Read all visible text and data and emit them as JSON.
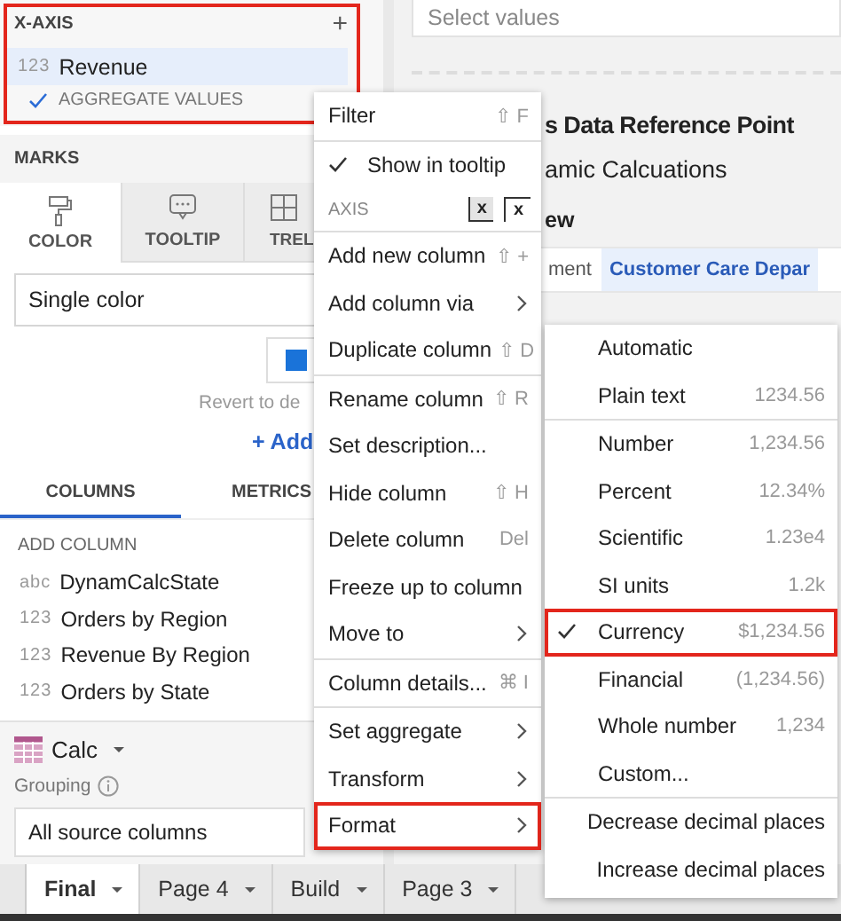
{
  "x_axis": {
    "title": "X-AXIS",
    "add": "+",
    "highlighted": true,
    "field": {
      "type": "123",
      "name": "Revenue"
    },
    "aggregate": {
      "label": "AGGREGATE VALUES",
      "checked": true
    }
  },
  "marks": {
    "title": "MARKS",
    "tabs": [
      {
        "label": "COLOR",
        "selected": true
      },
      {
        "label": "TOOLTIP",
        "selected": false
      },
      {
        "label": "TREL",
        "selected": false
      }
    ],
    "color_mode": "Single color",
    "revert": "Revert to de",
    "add": "+ Add"
  },
  "panel_tabs": [
    {
      "label": "COLUMNS",
      "selected": true
    },
    {
      "label": "METRICS",
      "selected": false
    }
  ],
  "add_column": "ADD COLUMN",
  "columns": [
    {
      "type": "abc",
      "name": "DynamCalcState"
    },
    {
      "type": "123",
      "name": "Orders by Region"
    },
    {
      "type": "123",
      "name": "Revenue By Region"
    },
    {
      "type": "123",
      "name": "Orders by State"
    }
  ],
  "element": {
    "name": "Calc",
    "grouping_label": "Grouping",
    "grouping_value": "All source columns"
  },
  "page_tabs": [
    {
      "label": "Final",
      "selected": true
    },
    {
      "label": "Page 4",
      "selected": false
    },
    {
      "label": "Build",
      "selected": false
    },
    {
      "label": "Page 3",
      "selected": false
    }
  ],
  "canvas": {
    "filter_placeholder": "Select values",
    "title": "s Data Reference Point",
    "subtitle": "amic Calcuations",
    "section": "ew",
    "cells": [
      {
        "text": "ment",
        "selected": false
      },
      {
        "text": "Customer Care Depar",
        "selected": true
      }
    ]
  },
  "column_menu": [
    {
      "kind": "item",
      "label": "Filter",
      "shortcut": "⇧ F",
      "submenu": false,
      "highlighted": false
    },
    {
      "kind": "divider"
    },
    {
      "kind": "check",
      "label": "Show in tooltip",
      "checked": true
    },
    {
      "kind": "header",
      "label": "AXIS",
      "options": [
        {
          "label": "x",
          "selected": true
        },
        {
          "label": "x",
          "selected": false
        }
      ]
    },
    {
      "kind": "divider"
    },
    {
      "kind": "item",
      "label": "Add new column",
      "shortcut": "⇧ +",
      "submenu": false,
      "highlighted": false
    },
    {
      "kind": "item",
      "label": "Add column via",
      "submenu": true,
      "highlighted": false
    },
    {
      "kind": "item",
      "label": "Duplicate column",
      "shortcut": "⇧ D",
      "submenu": false,
      "highlighted": false
    },
    {
      "kind": "divider"
    },
    {
      "kind": "item",
      "label": "Rename column",
      "shortcut": "⇧ R",
      "submenu": false,
      "highlighted": false
    },
    {
      "kind": "item",
      "label": "Set description...",
      "submenu": false,
      "highlighted": false
    },
    {
      "kind": "item",
      "label": "Hide column",
      "shortcut": "⇧ H",
      "submenu": false,
      "highlighted": false
    },
    {
      "kind": "item",
      "label": "Delete column",
      "shortcut": "Del",
      "submenu": false,
      "highlighted": false
    },
    {
      "kind": "item",
      "label": "Freeze up to column",
      "submenu": false,
      "highlighted": false
    },
    {
      "kind": "item",
      "label": "Move to",
      "submenu": true,
      "highlighted": false
    },
    {
      "kind": "divider"
    },
    {
      "kind": "item",
      "label": "Column details...",
      "shortcut": "⌘ I",
      "submenu": false,
      "highlighted": false
    },
    {
      "kind": "divider"
    },
    {
      "kind": "item",
      "label": "Set aggregate",
      "submenu": true,
      "highlighted": false
    },
    {
      "kind": "item",
      "label": "Transform",
      "submenu": true,
      "highlighted": false
    },
    {
      "kind": "item",
      "label": "Format",
      "submenu": true,
      "highlighted": true
    }
  ],
  "format_menu": [
    {
      "kind": "item",
      "label": "Automatic",
      "checked": false,
      "highlighted": false
    },
    {
      "kind": "item",
      "label": "Plain text",
      "sample": "1234.56",
      "checked": false,
      "highlighted": false
    },
    {
      "kind": "divider"
    },
    {
      "kind": "item",
      "label": "Number",
      "sample": "1,234.56",
      "checked": false,
      "highlighted": false
    },
    {
      "kind": "item",
      "label": "Percent",
      "sample": "12.34%",
      "checked": false,
      "highlighted": false
    },
    {
      "kind": "item",
      "label": "Scientific",
      "sample": "1.23e4",
      "checked": false,
      "highlighted": false
    },
    {
      "kind": "item",
      "label": "SI units",
      "sample": "1.2k",
      "checked": false,
      "highlighted": false
    },
    {
      "kind": "item",
      "label": "Currency",
      "sample": "$1,234.56",
      "checked": true,
      "highlighted": true
    },
    {
      "kind": "item",
      "label": "Financial",
      "sample": "(1,234.56)",
      "checked": false,
      "highlighted": false
    },
    {
      "kind": "item",
      "label": "Whole number",
      "sample": "1,234",
      "checked": false,
      "highlighted": false
    },
    {
      "kind": "item",
      "label": "Custom...",
      "checked": false,
      "highlighted": false
    },
    {
      "kind": "divider"
    },
    {
      "kind": "item",
      "label": "Decrease decimal places",
      "checked": false,
      "highlighted": false
    },
    {
      "kind": "item",
      "label": "Increase decimal places",
      "checked": false,
      "highlighted": false
    }
  ]
}
